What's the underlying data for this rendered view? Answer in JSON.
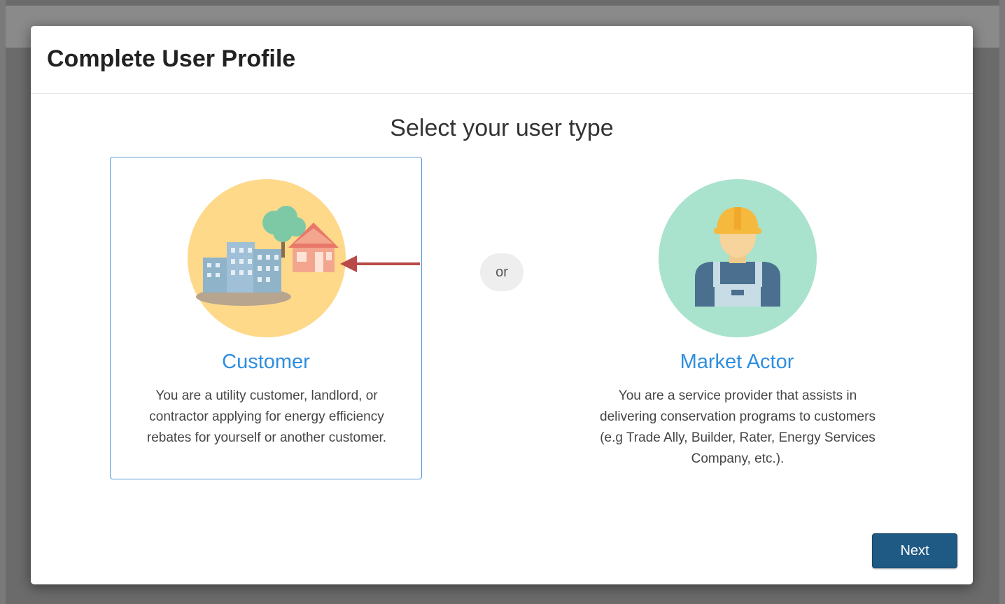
{
  "modal": {
    "title": "Complete User Profile",
    "subtitle": "Select your user type",
    "separator": "or",
    "next_label": "Next"
  },
  "options": [
    {
      "title": "Customer",
      "description": "You are a utility customer, landlord, or contractor applying for energy efficiency rebates for yourself or another customer.",
      "icon": "buildings-house-icon",
      "selected": true
    },
    {
      "title": "Market Actor",
      "description": "You are a service provider that assists in delivering conservation programs to customers (e.g Trade Ally, Builder, Rater, Energy Services Company, etc.).",
      "icon": "worker-icon",
      "selected": false
    }
  ],
  "colors": {
    "accent": "#2e8ee0",
    "button": "#1f5a85",
    "selected_border": "#5a9bd8",
    "annotation_arrow": "#b94a48"
  }
}
